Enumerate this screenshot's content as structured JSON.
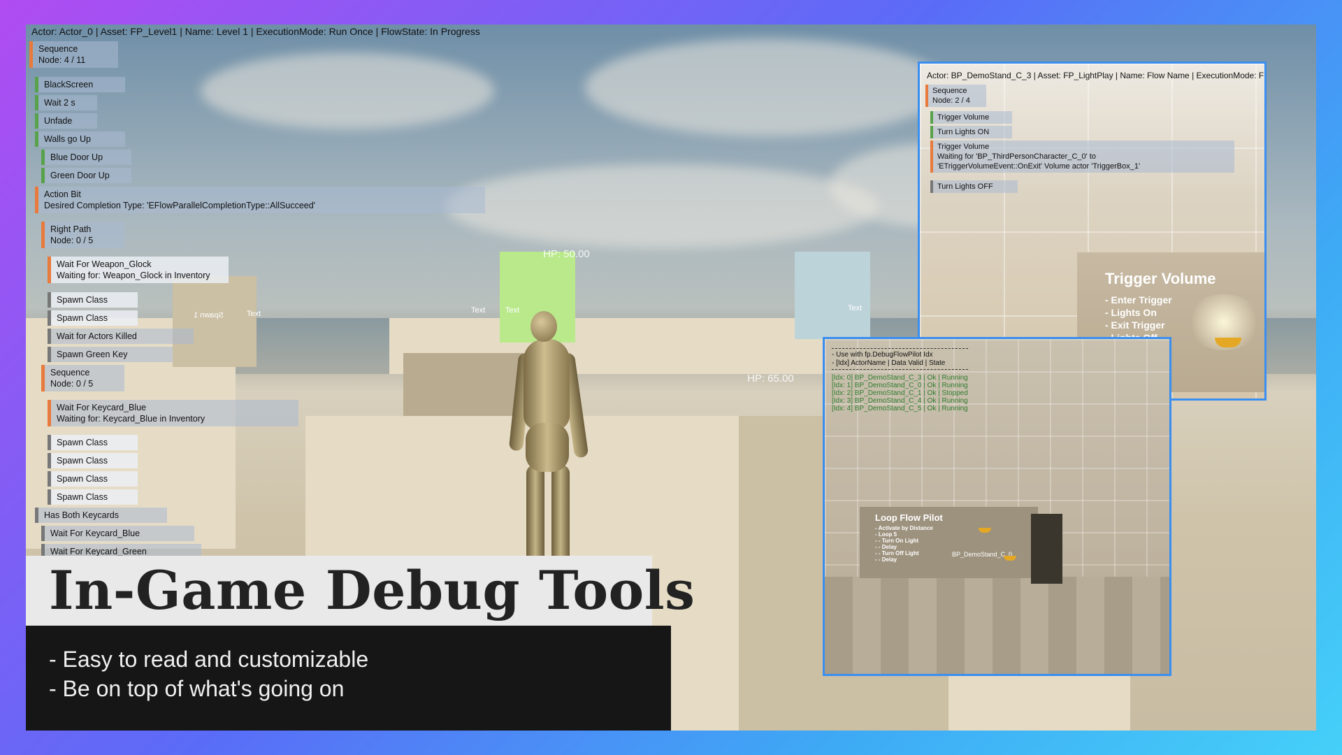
{
  "flow_debug": {
    "header": "Actor: Actor_0 | Asset: FP_Level1 | Name: Level 1 | ExecutionMode: Run Once | FlowState: In Progress",
    "nodes": [
      {
        "label": "Sequence",
        "sub": "Node: 4 / 11"
      },
      {
        "label": "BlackScreen"
      },
      {
        "label": "Wait 2 s"
      },
      {
        "label": "Unfade"
      },
      {
        "label": "Walls go Up"
      },
      {
        "label": "Blue Door Up"
      },
      {
        "label": "Green Door Up"
      },
      {
        "label": "Action Bit",
        "sub": "Desired Completion Type: 'EFlowParallelCompletionType::AllSucceed'"
      },
      {
        "label": "Right Path",
        "sub": "Node: 0 / 5"
      },
      {
        "label": "Wait For Weapon_Glock",
        "sub": "Waiting for: Weapon_Glock in Inventory"
      },
      {
        "label": "Spawn Class"
      },
      {
        "label": "Spawn Class"
      },
      {
        "label": "Wait for Actors Killed"
      },
      {
        "label": "Spawn Green Key"
      },
      {
        "label": "Sequence",
        "sub": "Node: 0 / 5"
      },
      {
        "label": "Wait For Keycard_Blue",
        "sub": "Waiting for: Keycard_Blue in Inventory"
      },
      {
        "label": "Spawn Class"
      },
      {
        "label": "Spawn Class"
      },
      {
        "label": "Spawn Class"
      },
      {
        "label": "Spawn Class"
      },
      {
        "label": "Has Both Keycards"
      },
      {
        "label": "Wait For Keycard_Blue"
      },
      {
        "label": "Wait For Keycard_Green"
      }
    ]
  },
  "world": {
    "hp_green": "HP: 50.00",
    "hp_floor": "HP: 65.00",
    "labels": [
      "Spawn 1",
      "Text",
      "Text",
      "Text",
      "Text"
    ]
  },
  "promo": {
    "title": "In-Game Debug Tools",
    "bullets": [
      "- Easy to read and customizable",
      "- Be on top of what's going on"
    ]
  },
  "inset1": {
    "header": "Actor: BP_DemoStand_C_3 | Asset: FP_LightPlay | Name: Flow Name | ExecutionMode: F",
    "nodes": [
      {
        "label": "Sequence",
        "sub": "Node: 2 / 4"
      },
      {
        "label": "Trigger Volume"
      },
      {
        "label": "Turn Lights ON"
      },
      {
        "label": "Trigger Volume",
        "sub": "Waiting for 'BP_ThirdPersonCharacter_C_0' to",
        "sub2": "'ETriggerVolumeEvent::OnExit' Volume actor 'TriggerBox_1'"
      },
      {
        "label": "Turn Lights OFF"
      }
    ],
    "sign": {
      "title": "Trigger Volume",
      "items": [
        "- Enter Trigger",
        "- Lights On",
        "- Exit Trigger",
        "- Lights Off"
      ]
    }
  },
  "inset2": {
    "console": {
      "line1": "- Use with fp.DebugFlowPilot Idx",
      "line2": "- [Idx] ActorName | Data Valid | State",
      "rows": [
        "[Idx: 0] BP_DemoStand_C_3 | Ok | Running",
        "[Idx: 1] BP_DemoStand_C_0 | Ok | Running",
        "[Idx: 2] BP_DemoStand_C_1 | Ok | Stopped",
        "[Idx: 3] BP_DemoStand_C_4 | Ok | Running",
        "[Idx: 4] BP_DemoStand_C_5 | Ok | Running"
      ]
    },
    "sign": {
      "title": "Loop Flow Pilot",
      "items": [
        "- Activate by Distance",
        "- Loop 5",
        "- - Turn On Light",
        "- - Delay",
        "- - Turn Off Light",
        "- - Delay"
      ],
      "tag": "BP_DemoStand_C_0"
    }
  }
}
